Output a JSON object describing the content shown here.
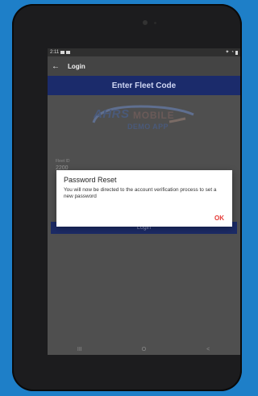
{
  "status_bar": {
    "time": "2:11"
  },
  "app_bar": {
    "title": "Login"
  },
  "fleet": {
    "header": "Enter Fleet Code"
  },
  "logo": {
    "word1": "AHRS",
    "word2": "MOBILE",
    "subtitle": "DEMO APP"
  },
  "form": {
    "field_label": "Fleet ID",
    "field_value": "2200",
    "login_label": "Login"
  },
  "dialog": {
    "title": "Password Reset",
    "message": "You will now be directed to the account verification process to set a new password",
    "ok_label": "OK"
  },
  "navigation": {
    "recents": "III",
    "home": "O",
    "back": "<"
  }
}
